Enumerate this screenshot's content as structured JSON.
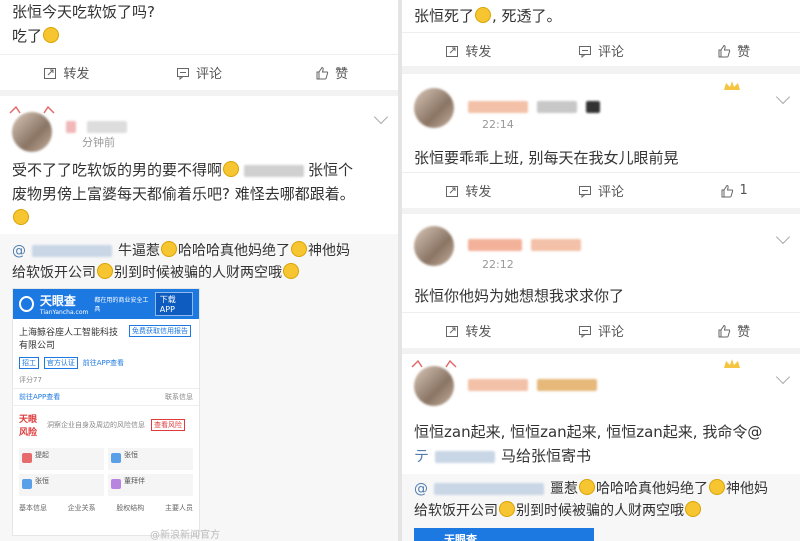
{
  "left": {
    "post1": {
      "lines": [
        "张恒今天吃软饭了吗?",
        "吃了"
      ],
      "actions": {
        "repost": "转发",
        "comment": "评论",
        "like": "赞"
      }
    },
    "post2": {
      "time": "分钟前",
      "text_a": "受不了了吃软饭的男的要不得啊",
      "text_b": "张恒个",
      "text_c": "废物男傍上富婆每天都偷着乐吧? 难怪去哪都跟着。",
      "quote_a": "牛逼惹",
      "quote_b": "哈哈哈真他妈绝了",
      "quote_c": "神他妈",
      "quote_d": "给软饭开公司",
      "quote_e": "别到时候被骗的人财两空哦",
      "ad": {
        "brand": "天眼查",
        "brand_sub": "TianYancha.com",
        "slogan_small": "都在用的商业安全工具",
        "download": "下载APP",
        "company": "上海鲸谷座人工智能科技",
        "company2": "有限公司",
        "free_report": "免费获取信用报告",
        "tag_info": "招工",
        "tag_verify": "官方认证",
        "score": "评分77",
        "link_app": "前往APP查看",
        "phone_label": "前往APP查看",
        "contact": "联系信息",
        "risk_title": "天眼风险",
        "risk_text": "洞察企业自身及周边的风险信息",
        "risk_btn": "查看风险",
        "cells": [
          "提起",
          "张恒",
          "张恒",
          "董拜伴"
        ],
        "bottom": [
          "基本信息",
          "企业关系",
          "股权结构",
          "主要人员"
        ]
      },
      "watermark": "@新浪新闻官方"
    }
  },
  "right": {
    "post1": {
      "text_a": "张恒死了",
      "text_b": ", 死透了。",
      "actions": {
        "repost": "转发",
        "comment": "评论",
        "like": "赞"
      }
    },
    "post2": {
      "time": "22:14",
      "text": "张恒要乖乖上班, 别每天在我女儿眼前晃",
      "actions": {
        "repost": "转发",
        "comment": "评论",
        "like_count": "1"
      }
    },
    "post3": {
      "time": "22:12",
      "text": "张恒你他妈为她想想我求求你了",
      "actions": {
        "repost": "转发",
        "comment": "评论",
        "like": "赞"
      }
    },
    "post4": {
      "text_a": "恒恒zan起来, 恒恒zan起来, 恒恒zan起来, 我命令@",
      "text_b": "马给张恒寄书",
      "quote_a": "噩惹",
      "quote_b": "哈哈哈真他妈绝了",
      "quote_c": "神他妈",
      "quote_d": "给软饭开公司",
      "quote_e": "别到时候被骗的人财两空哦",
      "ad_brand": "天眼查"
    }
  },
  "colors": {
    "accent": "#507daf",
    "brand": "#1d79e2",
    "emoji": "#f7c531"
  }
}
